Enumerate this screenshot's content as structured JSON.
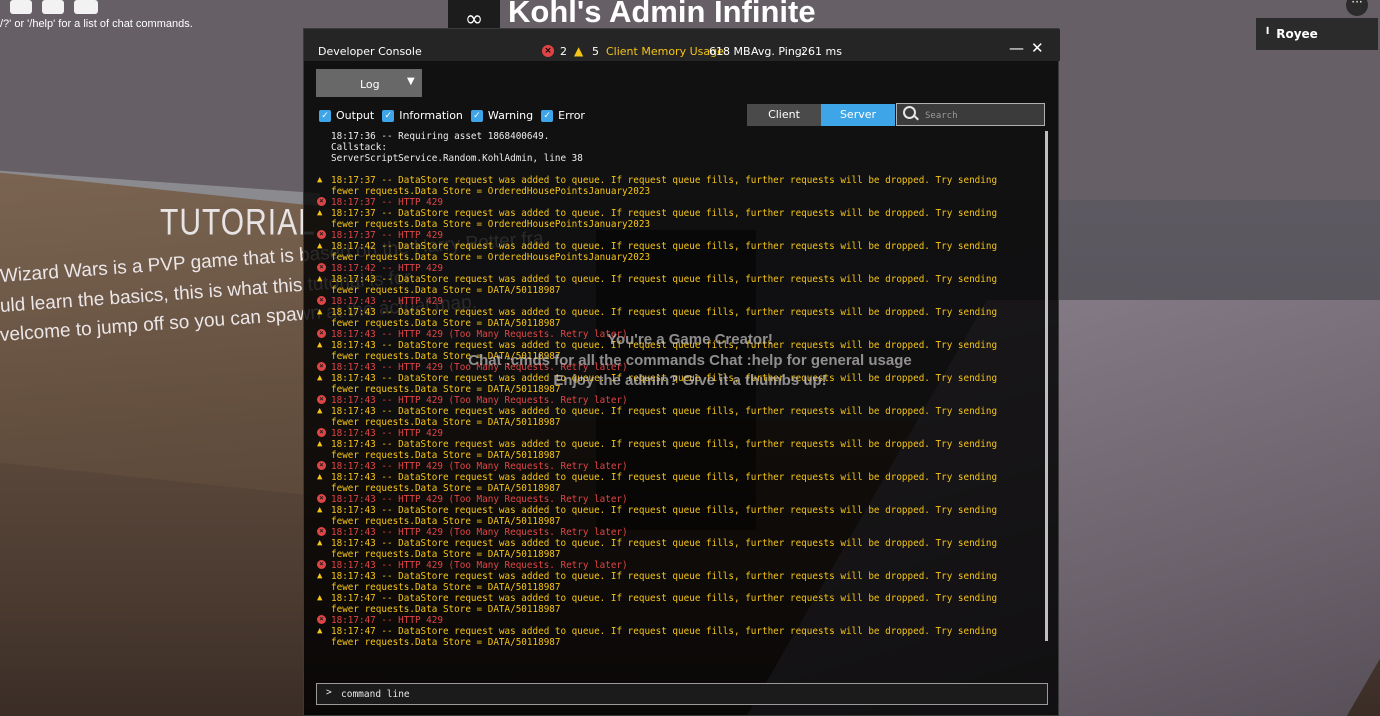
{
  "chat": {
    "hint": "/?' or '/help' for a list of chat commands."
  },
  "admin": {
    "logo": "∞",
    "title": "Kohl's Admin Infinite",
    "messages": [
      "You're a Game Creator!",
      "Chat :cmds for all the commands Chat :help for general usage",
      "Enjoy the admin? Give it a thumbs up!"
    ]
  },
  "player": {
    "name": "Royee"
  },
  "menu": {
    "glyph": "···"
  },
  "tutorial": {
    "title": "TUTORIAL",
    "lines": [
      "Wizard Wars is a PVP game that is based on the Harry Potter fra",
      "uld learn the basics, this is what this tutorial is for.",
      "velcome to jump off so you can spawn at the actual map."
    ]
  },
  "console": {
    "title": "Developer Console",
    "error_count": "2",
    "warning_count": "5",
    "memory_label": "Client Memory Usage:",
    "memory_value": "618 MB",
    "ping_label": "Avg. Ping:",
    "ping_value": "261 ms",
    "minimize_glyph": "—",
    "close_glyph": "✕",
    "view_select": "Log",
    "filters": [
      "Output",
      "Information",
      "Warning",
      "Error"
    ],
    "tabs": {
      "client": "Client",
      "server": "Server",
      "active": "Server"
    },
    "search_placeholder": "Search",
    "command_prompt": ">",
    "command_placeholder": "command line",
    "log": [
      {
        "type": "output",
        "text": "18:17:36 -- Requiring asset 1868400649.\nCallstack:\nServerScriptService.Random.KohlAdmin, line 38"
      },
      {
        "type": "gap",
        "text": ""
      },
      {
        "type": "warning",
        "text": "18:17:37 -- DataStore request was added to queue. If request queue fills, further requests will be dropped. Try sending\nfewer requests.Data Store = OrderedHousePointsJanuary2023"
      },
      {
        "type": "error",
        "text": "18:17:37 -- HTTP 429"
      },
      {
        "type": "warning",
        "text": "18:17:37 -- DataStore request was added to queue. If request queue fills, further requests will be dropped. Try sending\nfewer requests.Data Store = OrderedHousePointsJanuary2023"
      },
      {
        "type": "error",
        "text": "18:17:37 -- HTTP 429"
      },
      {
        "type": "warning",
        "text": "18:17:42 -- DataStore request was added to queue. If request queue fills, further requests will be dropped. Try sending\nfewer requests.Data Store = OrderedHousePointsJanuary2023"
      },
      {
        "type": "error",
        "text": "18:17:42 -- HTTP 429"
      },
      {
        "type": "warning",
        "text": "18:17:43 -- DataStore request was added to queue. If request queue fills, further requests will be dropped. Try sending\nfewer requests.Data Store = DATA/50118987"
      },
      {
        "type": "error",
        "text": "18:17:43 -- HTTP 429"
      },
      {
        "type": "warning",
        "text": "18:17:43 -- DataStore request was added to queue. If request queue fills, further requests will be dropped. Try sending\nfewer requests.Data Store = DATA/50118987"
      },
      {
        "type": "error",
        "text": "18:17:43 -- HTTP 429 (Too Many Requests. Retry later)"
      },
      {
        "type": "warning",
        "text": "18:17:43 -- DataStore request was added to queue. If request queue fills, further requests will be dropped. Try sending\nfewer requests.Data Store = DATA/50118987"
      },
      {
        "type": "error",
        "text": "18:17:43 -- HTTP 429 (Too Many Requests. Retry later)"
      },
      {
        "type": "warning",
        "text": "18:17:43 -- DataStore request was added to queue. If request queue fills, further requests will be dropped. Try sending\nfewer requests.Data Store = DATA/50118987"
      },
      {
        "type": "error",
        "text": "18:17:43 -- HTTP 429 (Too Many Requests. Retry later)"
      },
      {
        "type": "warning",
        "text": "18:17:43 -- DataStore request was added to queue. If request queue fills, further requests will be dropped. Try sending\nfewer requests.Data Store = DATA/50118987"
      },
      {
        "type": "error",
        "text": "18:17:43 -- HTTP 429"
      },
      {
        "type": "warning",
        "text": "18:17:43 -- DataStore request was added to queue. If request queue fills, further requests will be dropped. Try sending\nfewer requests.Data Store = DATA/50118987"
      },
      {
        "type": "error",
        "text": "18:17:43 -- HTTP 429 (Too Many Requests. Retry later)"
      },
      {
        "type": "warning",
        "text": "18:17:43 -- DataStore request was added to queue. If request queue fills, further requests will be dropped. Try sending\nfewer requests.Data Store = DATA/50118987"
      },
      {
        "type": "error",
        "text": "18:17:43 -- HTTP 429 (Too Many Requests. Retry later)"
      },
      {
        "type": "warning",
        "text": "18:17:43 -- DataStore request was added to queue. If request queue fills, further requests will be dropped. Try sending\nfewer requests.Data Store = DATA/50118987"
      },
      {
        "type": "error",
        "text": "18:17:43 -- HTTP 429 (Too Many Requests. Retry later)"
      },
      {
        "type": "warning",
        "text": "18:17:43 -- DataStore request was added to queue. If request queue fills, further requests will be dropped. Try sending\nfewer requests.Data Store = DATA/50118987"
      },
      {
        "type": "error",
        "text": "18:17:43 -- HTTP 429 (Too Many Requests. Retry later)"
      },
      {
        "type": "warning",
        "text": "18:17:43 -- DataStore request was added to queue. If request queue fills, further requests will be dropped. Try sending\nfewer requests.Data Store = DATA/50118987"
      },
      {
        "type": "warning",
        "text": "18:17:47 -- DataStore request was added to queue. If request queue fills, further requests will be dropped. Try sending\nfewer requests.Data Store = DATA/50118987"
      },
      {
        "type": "error",
        "text": "18:17:47 -- HTTP 429"
      },
      {
        "type": "warning",
        "text": "18:17:47 -- DataStore request was added to queue. If request queue fills, further requests will be dropped. Try sending\nfewer requests.Data Store = DATA/50118987"
      }
    ]
  },
  "colors": {
    "accent": "#3ea6e8",
    "warning": "#f5c518",
    "error": "#e04545",
    "output": "#ededed"
  }
}
